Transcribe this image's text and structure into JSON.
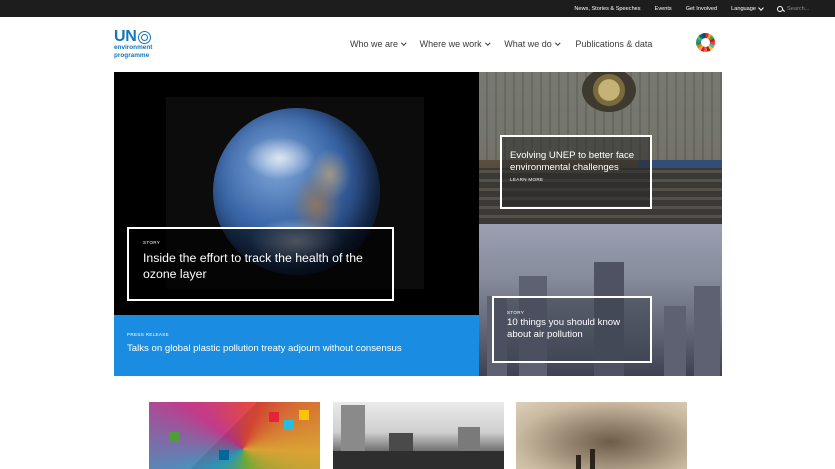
{
  "topbar": {
    "links": [
      "News, Stories & Speeches",
      "Events",
      "Get Involved"
    ],
    "language_label": "Language",
    "search_placeholder": "Search..."
  },
  "header": {
    "logo": {
      "line1": "UN",
      "line2": "environment",
      "line3": "programme"
    },
    "nav": [
      {
        "label": "Who we are",
        "has_dropdown": true
      },
      {
        "label": "Where we work",
        "has_dropdown": true
      },
      {
        "label": "What we do",
        "has_dropdown": true
      },
      {
        "label": "Publications & data",
        "has_dropdown": false
      }
    ]
  },
  "hero": {
    "main": {
      "tag": "STORY",
      "title": "Inside the effort to track the health of the ozone layer"
    },
    "press": {
      "tag": "PRESS RELEASE",
      "title": "Talks on global plastic pollution treaty adjourn without consensus"
    },
    "top_right": {
      "title": "Evolving UNEP to better face environmental challenges",
      "more": "LEARN MORE"
    },
    "bottom_right": {
      "tag": "STORY",
      "title": "10 things you should know about air pollution"
    }
  },
  "colors": {
    "topbar": "#1d1d1d",
    "brand_blue": "#1376b8",
    "press_blue": "#1a8de2"
  }
}
